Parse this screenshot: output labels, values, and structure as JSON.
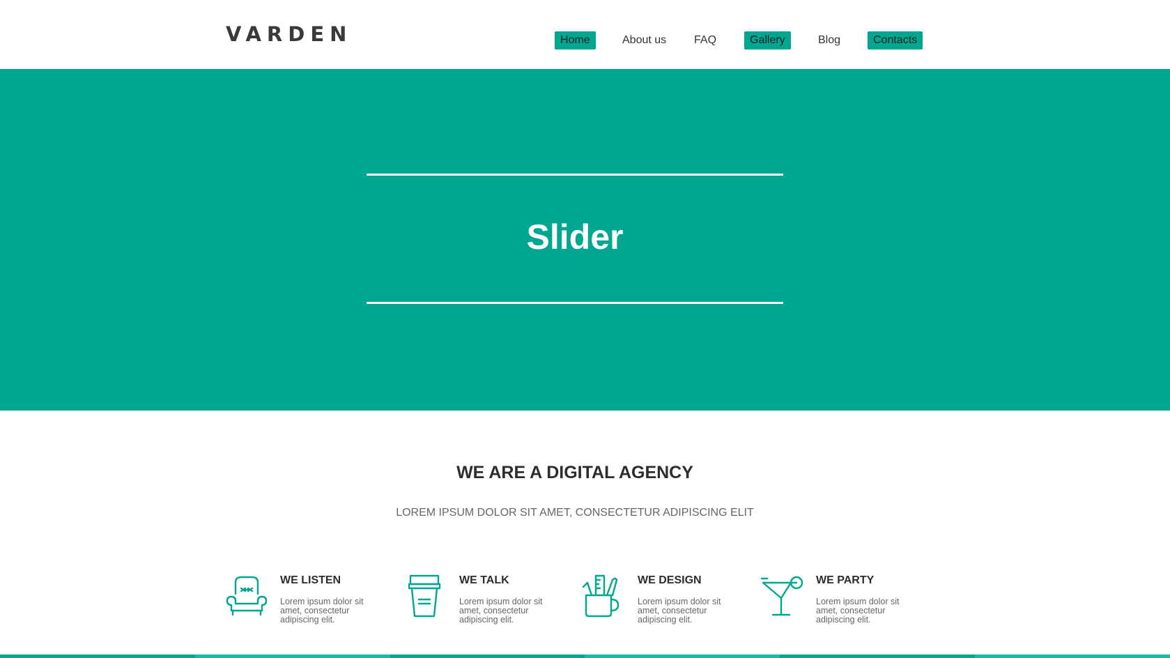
{
  "brand": {
    "logo": "VARDEN"
  },
  "nav": {
    "items": [
      {
        "label": "Home",
        "active": true
      },
      {
        "label": "About us",
        "active": false
      },
      {
        "label": "FAQ",
        "active": false
      },
      {
        "label": "Gallery",
        "active": true
      },
      {
        "label": "Blog",
        "active": false
      },
      {
        "label": "Contacts",
        "active": true
      }
    ]
  },
  "hero": {
    "title": "Slider"
  },
  "intro": {
    "title": "WE ARE A DIGITAL AGENCY",
    "subtitle": "LOREM IPSUM DOLOR SIT AMET, CONSECTETUR ADIPISCING ELIT"
  },
  "features": [
    {
      "icon": "armchair-icon",
      "title": "WE LISTEN",
      "text": "Lorem ipsum dolor sit amet, consectetur adipiscing elit."
    },
    {
      "icon": "coffee-cup-icon",
      "title": "WE TALK",
      "text": "Lorem ipsum dolor sit amet, consectetur adipiscing elit."
    },
    {
      "icon": "design-tools-icon",
      "title": "WE DESIGN",
      "text": "Lorem ipsum dolor sit amet, consectetur adipiscing elit."
    },
    {
      "icon": "cocktail-icon",
      "title": "WE PARTY",
      "text": "Lorem ipsum dolor sit amet, consectetur adipiscing elit."
    }
  ],
  "colors": {
    "accent": "#00a790",
    "bottom_bar": [
      "#00a790",
      "#16bca3",
      "#00a790",
      "#16bca3",
      "#00a790",
      "#16bca3"
    ]
  }
}
